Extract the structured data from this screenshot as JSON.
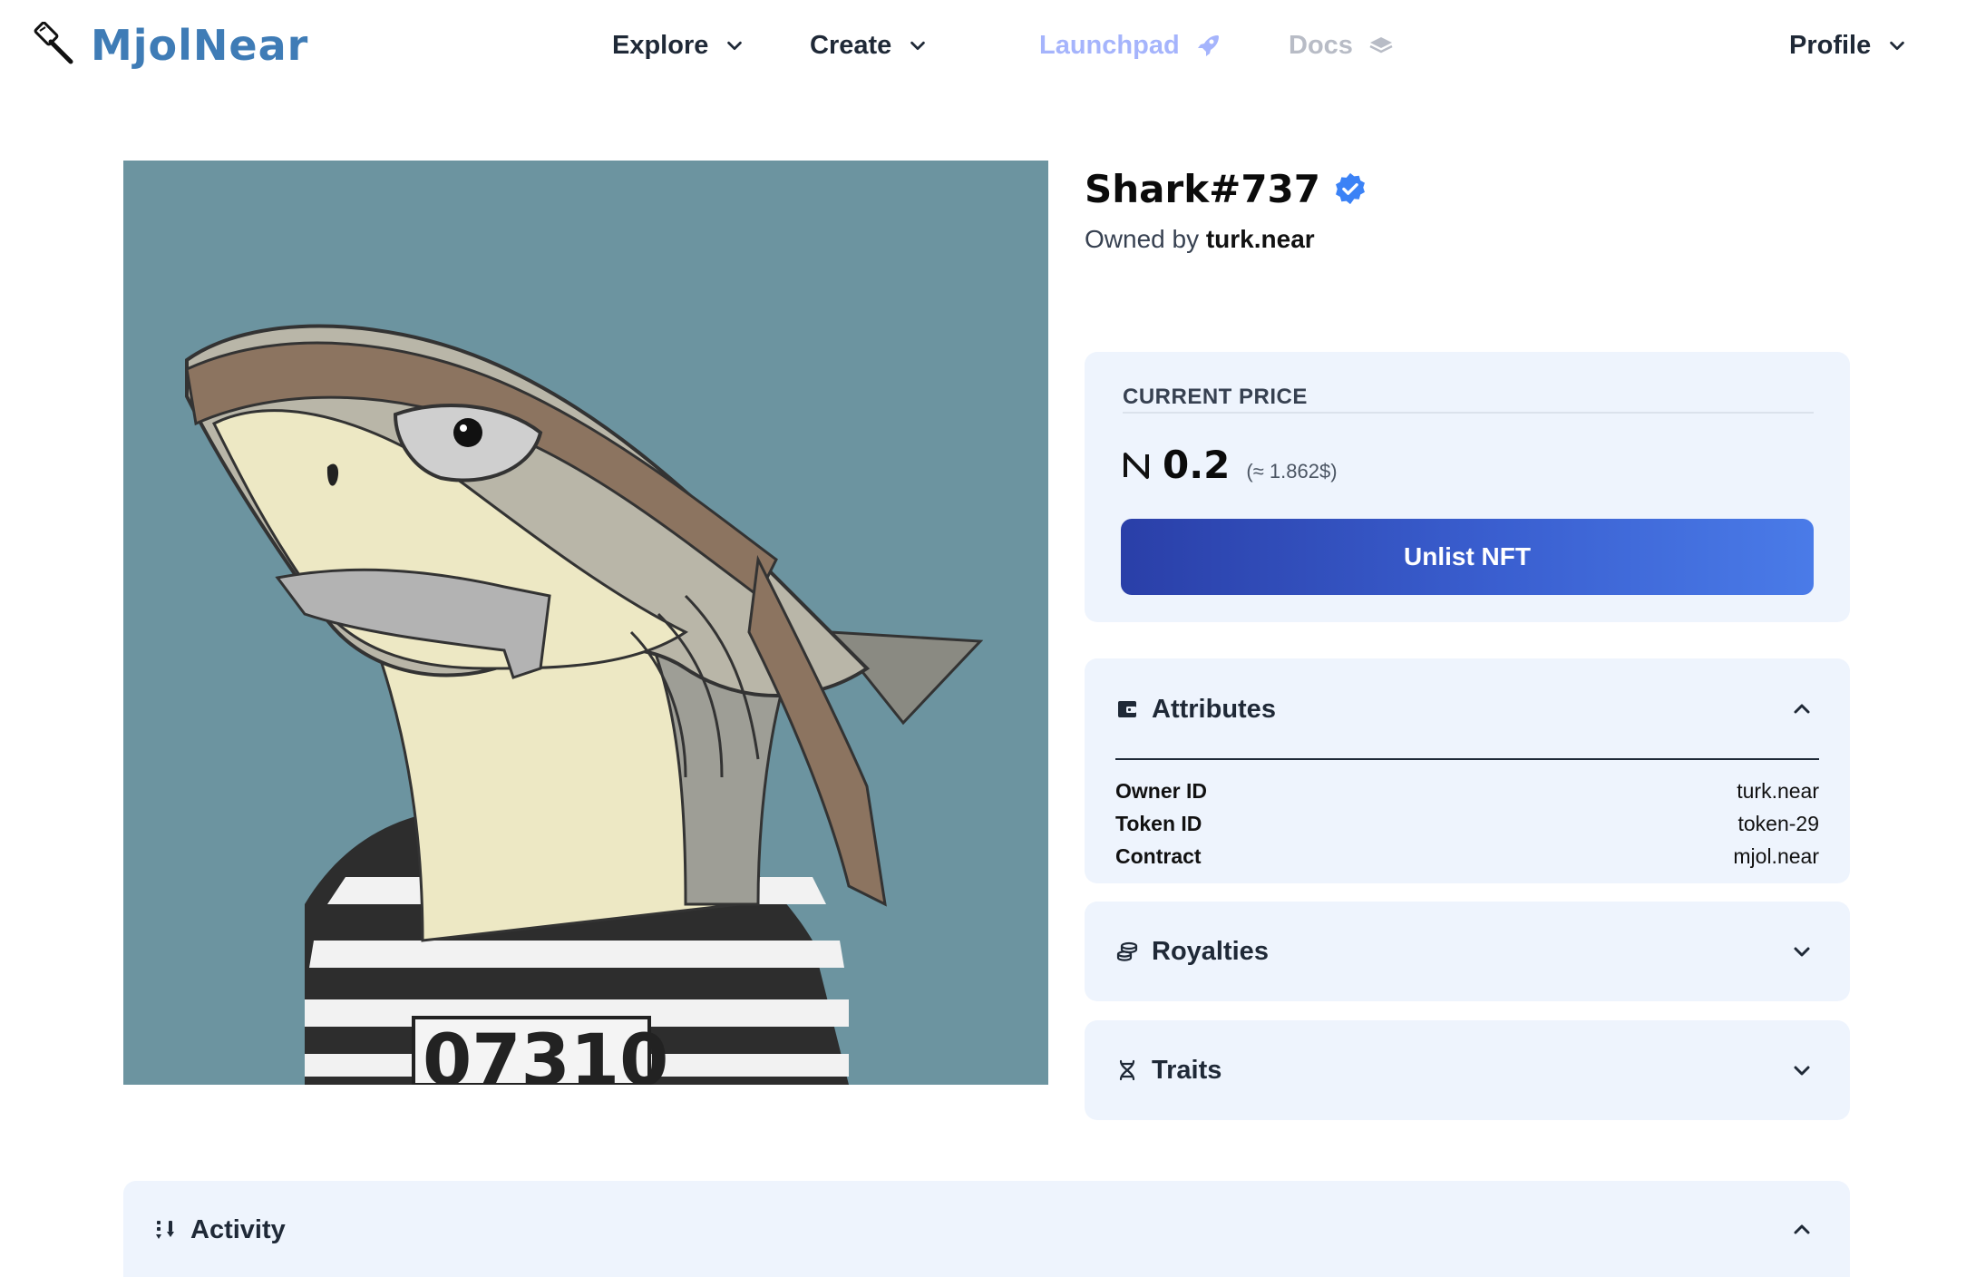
{
  "brand": {
    "name": "MjolNear"
  },
  "nav": {
    "explore": "Explore",
    "create": "Create",
    "launchpad": "Launchpad",
    "docs": "Docs",
    "profile": "Profile"
  },
  "nft": {
    "title": "Shark#737",
    "owned_by_label": "Owned by",
    "owner": "turk.near",
    "image_text": "07310"
  },
  "price": {
    "label": "CURRENT PRICE",
    "value": "0.2",
    "usd": "(≈ 1.862$)",
    "button": "Unlist NFT"
  },
  "attributes": {
    "title": "Attributes",
    "rows": [
      {
        "key": "Owner ID",
        "value": "turk.near"
      },
      {
        "key": "Token ID",
        "value": "token-29"
      },
      {
        "key": "Contract",
        "value": "mjol.near"
      }
    ]
  },
  "royalties": {
    "title": "Royalties"
  },
  "traits": {
    "title": "Traits"
  },
  "activity": {
    "title": "Activity"
  },
  "colors": {
    "accent": "#3f7cb6",
    "button_start": "#2a3fa8",
    "button_end": "#4a7be8",
    "card_bg": "#eef4fd",
    "image_bg": "#6c94a0",
    "verified": "#3b82f6"
  },
  "icons": {
    "logo": "hammer-icon",
    "launchpad": "rocket-icon",
    "docs": "book-icon",
    "verified": "verified-badge-icon",
    "price": "near-icon",
    "attributes": "wallet-icon",
    "royalties": "coins-icon",
    "traits": "dna-icon",
    "activity": "sort-icon"
  }
}
